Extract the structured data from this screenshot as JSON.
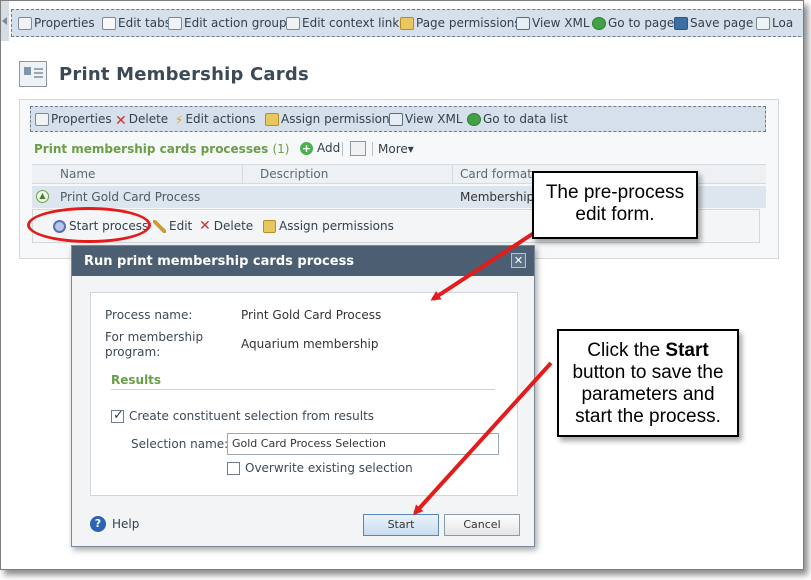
{
  "page_toolbar": {
    "items": [
      {
        "label": "Properties",
        "icon": "properties-icon"
      },
      {
        "label": "Edit tabs",
        "icon": "tabs-icon"
      },
      {
        "label": "Edit action groups",
        "icon": "action-groups-icon"
      },
      {
        "label": "Edit context links",
        "icon": "link-icon"
      },
      {
        "label": "Page permissions",
        "icon": "permissions-icon"
      },
      {
        "label": "View XML",
        "icon": "xml-icon"
      },
      {
        "label": "Go to page",
        "icon": "go-icon"
      },
      {
        "label": "Save page",
        "icon": "save-icon"
      },
      {
        "label": "Loa",
        "icon": "load-icon"
      }
    ]
  },
  "page": {
    "title": "Print Membership Cards"
  },
  "panel_toolbar": {
    "items": [
      {
        "label": "Properties"
      },
      {
        "label": "Delete"
      },
      {
        "label": "Edit actions"
      },
      {
        "label": "Assign permissions"
      },
      {
        "label": "View XML"
      },
      {
        "label": "Go to data list"
      }
    ]
  },
  "list": {
    "title": "Print membership cards processes",
    "count": "(1)",
    "add_label": "Add",
    "more_label": "More▾",
    "columns": [
      "Name",
      "Description",
      "Card format"
    ],
    "rows": [
      {
        "name": "Print Gold Card Process",
        "description": "",
        "card_format": "Membership C"
      }
    ],
    "row_actions": [
      "Start process",
      "Edit",
      "Delete",
      "Assign permissions"
    ]
  },
  "dialog": {
    "title": "Run print membership cards process",
    "close_glyph": "✕",
    "process_name_label": "Process name:",
    "process_name_value": "Print Gold Card Process",
    "program_label_line1": "For membership",
    "program_label_line2": "program:",
    "program_value": "Aquarium membership",
    "results_heading": "Results",
    "create_selection_label": "Create constituent selection from results",
    "create_selection_checked": true,
    "selection_name_label": "Selection name:",
    "selection_name_value": "Gold Card Process Selection",
    "overwrite_label": "Overwrite existing selection",
    "overwrite_checked": false,
    "help_label": "Help",
    "start_label": "Start",
    "cancel_label": "Cancel"
  },
  "callouts": {
    "callout1_line1": "The pre-process",
    "callout1_line2": "edit form.",
    "callout2_line1_pre": "Click the ",
    "callout2_line1_bold": "Start",
    "callout2_line2": "button to save the",
    "callout2_line3": "parameters and",
    "callout2_line4": "start the process."
  },
  "colors": {
    "annotation_red": "#e31b1b",
    "dialog_title_bar": "#4c5f72",
    "section_green": "#6a9e48",
    "toolbar_bg": "#d5e0ea"
  }
}
